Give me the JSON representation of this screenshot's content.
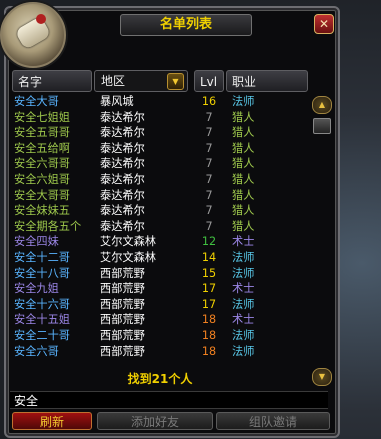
{
  "window": {
    "title": "名单列表",
    "close_glyph": "✕"
  },
  "columns": {
    "name": "名字",
    "zone_dropdown": "地区",
    "level": "Lvl",
    "class": "职业"
  },
  "rows": [
    {
      "name": "安全大哥",
      "name_color": "#59b4ff",
      "zone": "暴风城",
      "level": "16",
      "level_color": "#f0d000",
      "class": "法师",
      "class_color": "#59c8e8"
    },
    {
      "name": "安全七姐姐",
      "name_color": "#9ec84c",
      "zone": "泰达希尔",
      "level": "7",
      "level_color": "#9a9a9a",
      "class": "猎人",
      "class_color": "#9ec84c"
    },
    {
      "name": "安全五哥哥",
      "name_color": "#9ec84c",
      "zone": "泰达希尔",
      "level": "7",
      "level_color": "#9a9a9a",
      "class": "猎人",
      "class_color": "#9ec84c"
    },
    {
      "name": "安全五给啊",
      "name_color": "#9ec84c",
      "zone": "泰达希尔",
      "level": "7",
      "level_color": "#9a9a9a",
      "class": "猎人",
      "class_color": "#9ec84c"
    },
    {
      "name": "安全六哥哥",
      "name_color": "#9ec84c",
      "zone": "泰达希尔",
      "level": "7",
      "level_color": "#9a9a9a",
      "class": "猎人",
      "class_color": "#9ec84c"
    },
    {
      "name": "安全六姐哥",
      "name_color": "#9ec84c",
      "zone": "泰达希尔",
      "level": "7",
      "level_color": "#9a9a9a",
      "class": "猎人",
      "class_color": "#9ec84c"
    },
    {
      "name": "安全大哥哥",
      "name_color": "#9ec84c",
      "zone": "泰达希尔",
      "level": "7",
      "level_color": "#9a9a9a",
      "class": "猎人",
      "class_color": "#9ec84c"
    },
    {
      "name": "安全妹妹五",
      "name_color": "#9ec84c",
      "zone": "泰达希尔",
      "level": "7",
      "level_color": "#9a9a9a",
      "class": "猎人",
      "class_color": "#9ec84c"
    },
    {
      "name": "安全期各五个",
      "name_color": "#9ec84c",
      "zone": "泰达希尔",
      "level": "7",
      "level_color": "#9a9a9a",
      "class": "猎人",
      "class_color": "#9ec84c"
    },
    {
      "name": "安全四妹",
      "name_color": "#9b86e6",
      "zone": "艾尔文森林",
      "level": "12",
      "level_color": "#40c040",
      "class": "术士",
      "class_color": "#9b86e6"
    },
    {
      "name": "安全十二哥",
      "name_color": "#59b4ff",
      "zone": "艾尔文森林",
      "level": "14",
      "level_color": "#f0d000",
      "class": "法师",
      "class_color": "#59c8e8"
    },
    {
      "name": "安全十八哥",
      "name_color": "#59b4ff",
      "zone": "西部荒野",
      "level": "15",
      "level_color": "#f0d000",
      "class": "法师",
      "class_color": "#59c8e8"
    },
    {
      "name": "安全九姐",
      "name_color": "#9b86e6",
      "zone": "西部荒野",
      "level": "17",
      "level_color": "#f0d000",
      "class": "术士",
      "class_color": "#9b86e6"
    },
    {
      "name": "安全十六哥",
      "name_color": "#59b4ff",
      "zone": "西部荒野",
      "level": "17",
      "level_color": "#f0d000",
      "class": "法师",
      "class_color": "#59c8e8"
    },
    {
      "name": "安全十五姐",
      "name_color": "#9b86e6",
      "zone": "西部荒野",
      "level": "18",
      "level_color": "#f08020",
      "class": "术士",
      "class_color": "#9b86e6"
    },
    {
      "name": "安全二十哥",
      "name_color": "#59b4ff",
      "zone": "西部荒野",
      "level": "18",
      "level_color": "#f08020",
      "class": "法师",
      "class_color": "#59c8e8"
    },
    {
      "name": "安全六哥",
      "name_color": "#59b4ff",
      "zone": "西部荒野",
      "level": "18",
      "level_color": "#f08020",
      "class": "法师",
      "class_color": "#59c8e8"
    }
  ],
  "footer": {
    "found_text": "找到21个人"
  },
  "search": {
    "value": "安全"
  },
  "buttons": {
    "refresh": "刷新",
    "add_friend": "添加好友",
    "group_invite": "组队邀请"
  },
  "icons": {
    "scroll_up": "▲",
    "scroll_down": "▼",
    "dropdown": "▼"
  }
}
